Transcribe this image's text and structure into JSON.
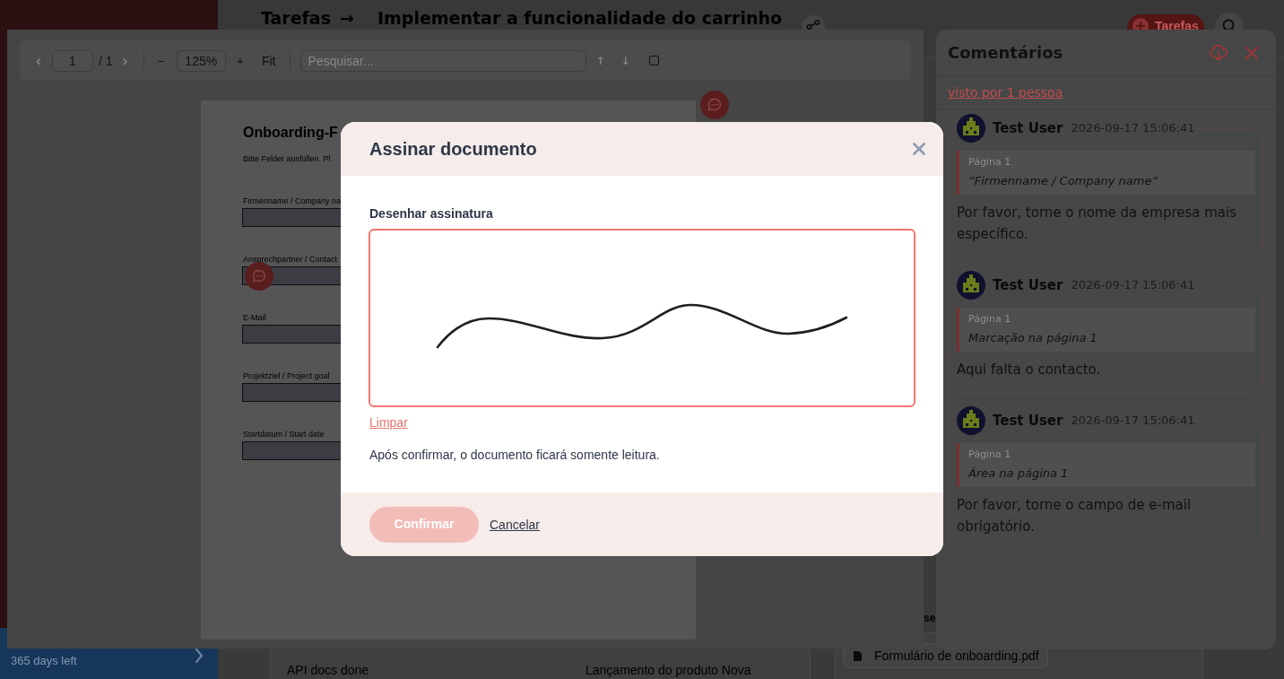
{
  "app": {
    "sidebar": {
      "trial_note": "365 days left"
    },
    "header": {
      "breadcrumb": "Tarefas",
      "separator": "→",
      "title": "Implementar a funcionalidade do carrinho",
      "new_task_button": "Tarefas"
    },
    "content": {
      "task_row": [
        "API docs done",
        "Lançamento do produto Nova"
      ],
      "section_heading": "se",
      "attachment": "Formulário de onboarding.pdf"
    }
  },
  "pdf_viewer": {
    "toolbar": {
      "prev_page": {
        "label": "‹",
        "disabled": true
      },
      "page_input": {
        "value": "1"
      },
      "page_total": "/ 1",
      "next_page": {
        "label": "›",
        "disabled": true
      },
      "zoom_out": "−",
      "zoom_input": {
        "value": "125%"
      },
      "zoom_in": "+",
      "fit": "Fit",
      "search": {
        "placeholder": "Pesquisar..."
      },
      "search_prev": {
        "label": "↑",
        "disabled": true
      },
      "search_next": {
        "label": "↓",
        "disabled": true
      },
      "toolbar_checkbox": {
        "checked": false
      }
    },
    "document": {
      "title": "Onboarding-F",
      "subtitle": "Bitte Felder ausfüllen. Pl",
      "fields": [
        {
          "label": "Firmenname / Company na"
        },
        {
          "label": "Ansprechpartner / Contact"
        },
        {
          "label": "E-Mail"
        },
        {
          "label": "Projektziel / Project goal"
        },
        {
          "label": "Startdatum / Start date"
        }
      ]
    }
  },
  "comments_panel": {
    "title": "Comentários",
    "seen_by": "visto por 1 pessoa",
    "comments": [
      {
        "author": "Test User",
        "time": "2026-09-17 15:06:41",
        "page": "Página 1",
        "quote": "“Firmenname / Company name”",
        "text": "Por favor, torne o nome da empresa mais específico."
      },
      {
        "author": "Test User",
        "time": "2026-09-17 15:06:41",
        "page": "Página 1",
        "quote": "Marcação na página 1",
        "text": "Aqui falta o contacto."
      },
      {
        "author": "Test User",
        "time": "2026-09-17 15:06:41",
        "page": "Página 1",
        "quote": "Área na página 1",
        "text": "Por favor, torne o campo de e-mail obrigatório."
      }
    ]
  },
  "sign_dialog": {
    "title": "Assinar documento",
    "pad_label": "Desenhar assinatura",
    "clear_link": "Limpar",
    "note": "Após confirmar, o documento ficará somente leitura.",
    "buttons": [
      {
        "kind": "primary",
        "label": "Confirmar",
        "disabled": true
      },
      {
        "kind": "link",
        "label": "Cancelar",
        "disabled": false
      }
    ]
  }
}
